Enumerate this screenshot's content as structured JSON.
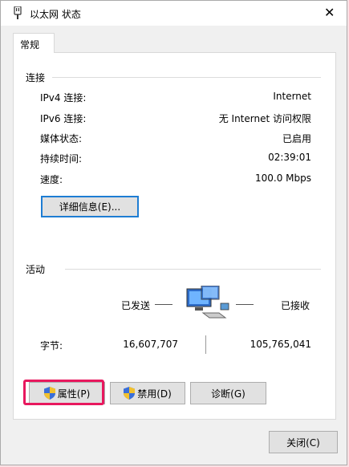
{
  "window": {
    "title": "以太网 状态",
    "close_label": "✕"
  },
  "tabs": [
    {
      "label": "常规"
    }
  ],
  "connection": {
    "group_label": "连接",
    "rows": [
      {
        "label": "IPv4 连接:",
        "value": "Internet"
      },
      {
        "label": "IPv6 连接:",
        "value": "无 Internet 访问权限"
      },
      {
        "label": "媒体状态:",
        "value": "已启用"
      },
      {
        "label": "持续时间:",
        "value": "02:39:01"
      },
      {
        "label": "速度:",
        "value": "100.0 Mbps"
      }
    ],
    "details_button": "详细信息(E)..."
  },
  "activity": {
    "group_label": "活动",
    "sent_label": "已发送",
    "received_label": "已接收",
    "bytes_label": "字节:",
    "bytes_sent": "16,607,707",
    "bytes_received": "105,765,041"
  },
  "actions": {
    "properties": "属性(P)",
    "disable": "禁用(D)",
    "diagnose": "诊断(G)"
  },
  "footer": {
    "close": "关闭(C)"
  },
  "icons": {
    "title": "network-adapter-icon",
    "activity": "network-computers-icon",
    "shield": "uac-shield-icon"
  },
  "colors": {
    "highlight": "#e8185e",
    "focus_border": "#1e7dd3"
  }
}
